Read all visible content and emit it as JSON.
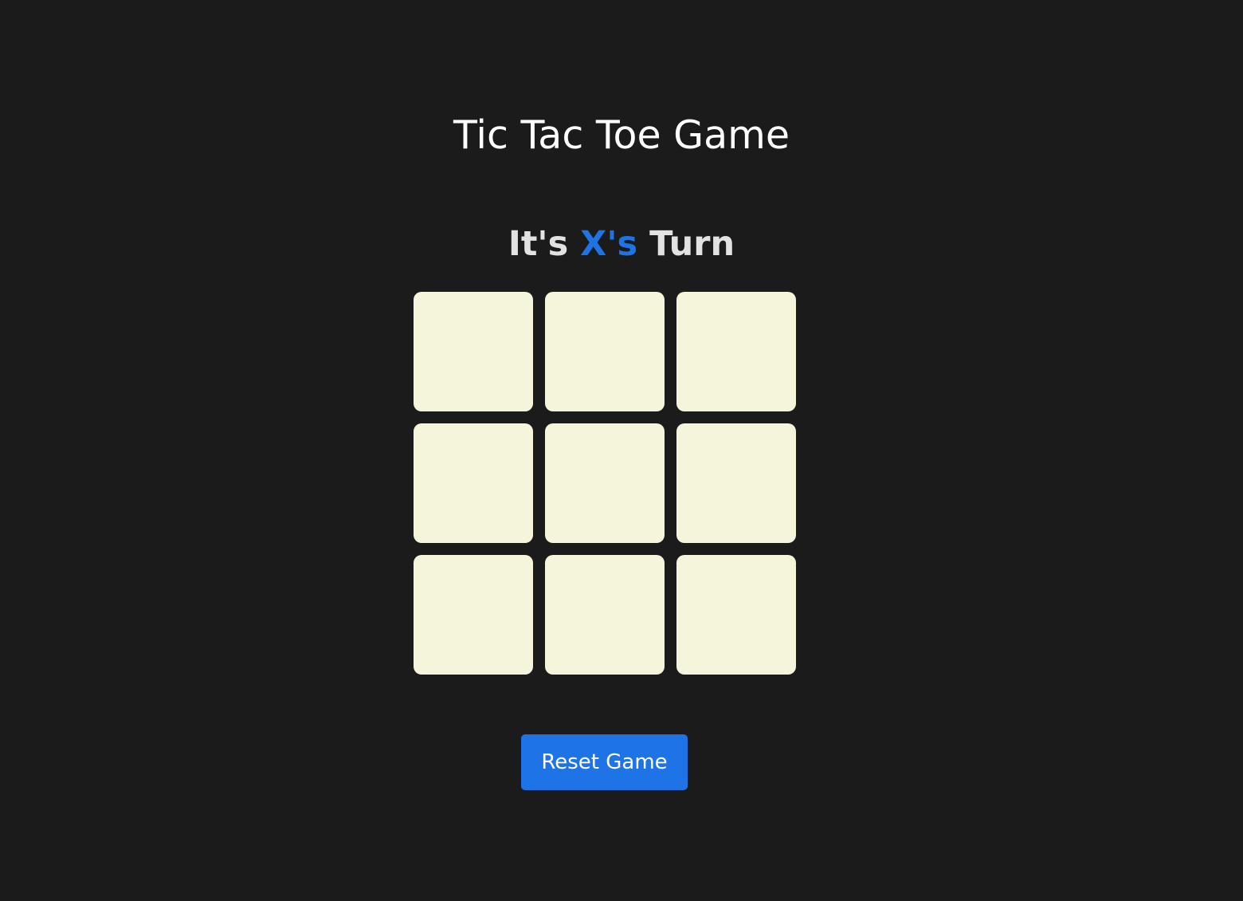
{
  "game": {
    "title": "Tic Tac Toe Game",
    "turn": {
      "prefix": "It's ",
      "player": "X's",
      "suffix": " Turn"
    },
    "board": [
      "",
      "",
      "",
      "",
      "",
      "",
      "",
      "",
      ""
    ],
    "reset_label": "Reset Game"
  },
  "colors": {
    "background": "#1b1b1b",
    "accent": "#1e74e6",
    "cell": "#f5f5dc",
    "title": "#ffffff",
    "turn_text": "#e2e2e2"
  }
}
